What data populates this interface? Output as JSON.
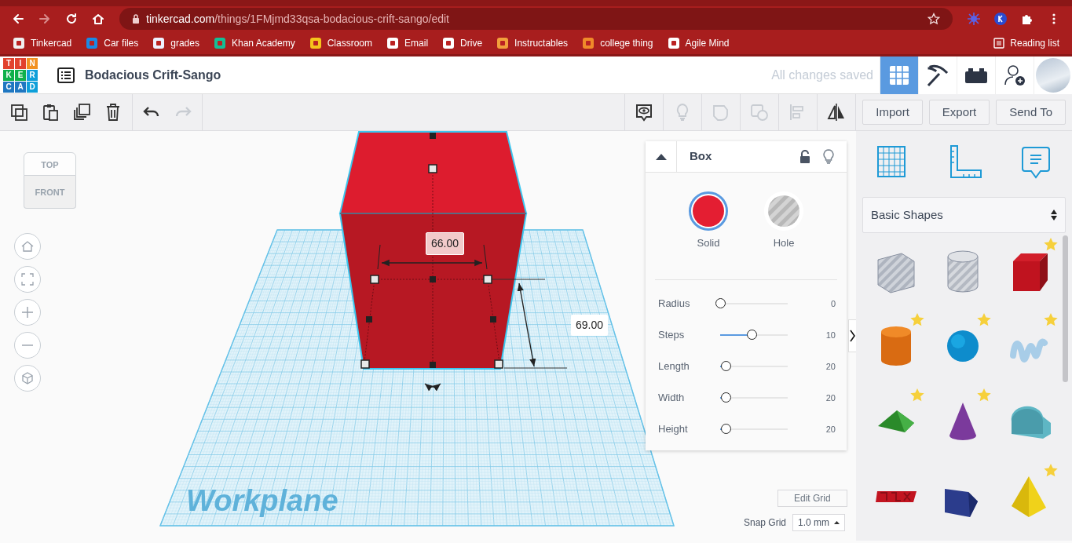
{
  "browser": {
    "url_host": "tinkercad.com",
    "url_path": "/things/1FMjmd33qsa-bodacious-crift-sango/edit",
    "forward_disabled": true,
    "bookmarks": [
      {
        "label": "Tinkercad"
      },
      {
        "label": "Car files"
      },
      {
        "label": "grades"
      },
      {
        "label": "Khan Academy"
      },
      {
        "label": "Classroom"
      },
      {
        "label": "Email"
      },
      {
        "label": "Drive"
      },
      {
        "label": "Instructables"
      },
      {
        "label": "college thing"
      },
      {
        "label": "Agile Mind"
      }
    ],
    "reading_list": "Reading list"
  },
  "app": {
    "logo": [
      "T",
      "I",
      "N",
      "K",
      "E",
      "R",
      "C",
      "A",
      "D"
    ],
    "title": "Bodacious Crift-Sango",
    "save_status": "All changes saved",
    "views": [
      {
        "kind": "grid",
        "selected": true
      },
      {
        "kind": "pickaxe",
        "selected": false
      },
      {
        "kind": "bricks",
        "selected": false
      }
    ]
  },
  "toolbar": {
    "left_groups": [
      [
        {
          "kind": "copy",
          "disabled": false
        },
        {
          "kind": "paste",
          "disabled": false
        },
        {
          "kind": "duplicate",
          "disabled": false
        },
        {
          "kind": "delete",
          "disabled": false
        }
      ],
      [
        {
          "kind": "undo",
          "disabled": false
        },
        {
          "kind": "redo",
          "disabled": true
        }
      ]
    ],
    "right_groups": [
      [
        {
          "kind": "note",
          "disabled": false
        }
      ],
      [
        {
          "kind": "bulb",
          "disabled": true
        }
      ],
      [
        {
          "kind": "group",
          "disabled": true
        }
      ],
      [
        {
          "kind": "ungroup",
          "disabled": true
        }
      ],
      [
        {
          "kind": "align",
          "disabled": true
        }
      ],
      [
        {
          "kind": "mirror",
          "disabled": false
        }
      ]
    ],
    "actions": [
      "Import",
      "Export",
      "Send To"
    ]
  },
  "view_cube": {
    "top": "TOP",
    "front": "FRONT"
  },
  "scene": {
    "width_dimension": "66.00",
    "depth_dimension": "69.00",
    "workplane_label": "Workplane"
  },
  "inspector": {
    "title": "Box",
    "modes": [
      {
        "label": "Solid",
        "kind": "solid",
        "selected": true
      },
      {
        "label": "Hole",
        "kind": "hole",
        "selected": false
      }
    ],
    "params": [
      {
        "label": "Radius",
        "value": "0",
        "level": 0
      },
      {
        "label": "Steps",
        "value": "10",
        "level": 0.47
      },
      {
        "label": "Length",
        "value": "20",
        "level": 0.09
      },
      {
        "label": "Width",
        "value": "20",
        "level": 0.09
      },
      {
        "label": "Height",
        "value": "20",
        "level": 0.09
      }
    ]
  },
  "grid": {
    "edit_grid": "Edit Grid",
    "snap_label": "Snap Grid",
    "snap_value": "1.0 mm"
  },
  "library": {
    "category": "Basic Shapes",
    "shapes": [
      {
        "kind": "box-hole",
        "starred": false
      },
      {
        "kind": "cylinder-hole",
        "starred": false
      },
      {
        "kind": "box",
        "starred": true
      },
      {
        "kind": "cylinder",
        "starred": true
      },
      {
        "kind": "sphere",
        "starred": true
      },
      {
        "kind": "scribble",
        "starred": true
      },
      {
        "kind": "roof",
        "starred": true
      },
      {
        "kind": "cone",
        "starred": true
      },
      {
        "kind": "round-roof",
        "starred": false
      },
      {
        "kind": "text",
        "starred": false
      },
      {
        "kind": "prism",
        "starred": false
      },
      {
        "kind": "pyramid",
        "starred": true
      }
    ]
  }
}
